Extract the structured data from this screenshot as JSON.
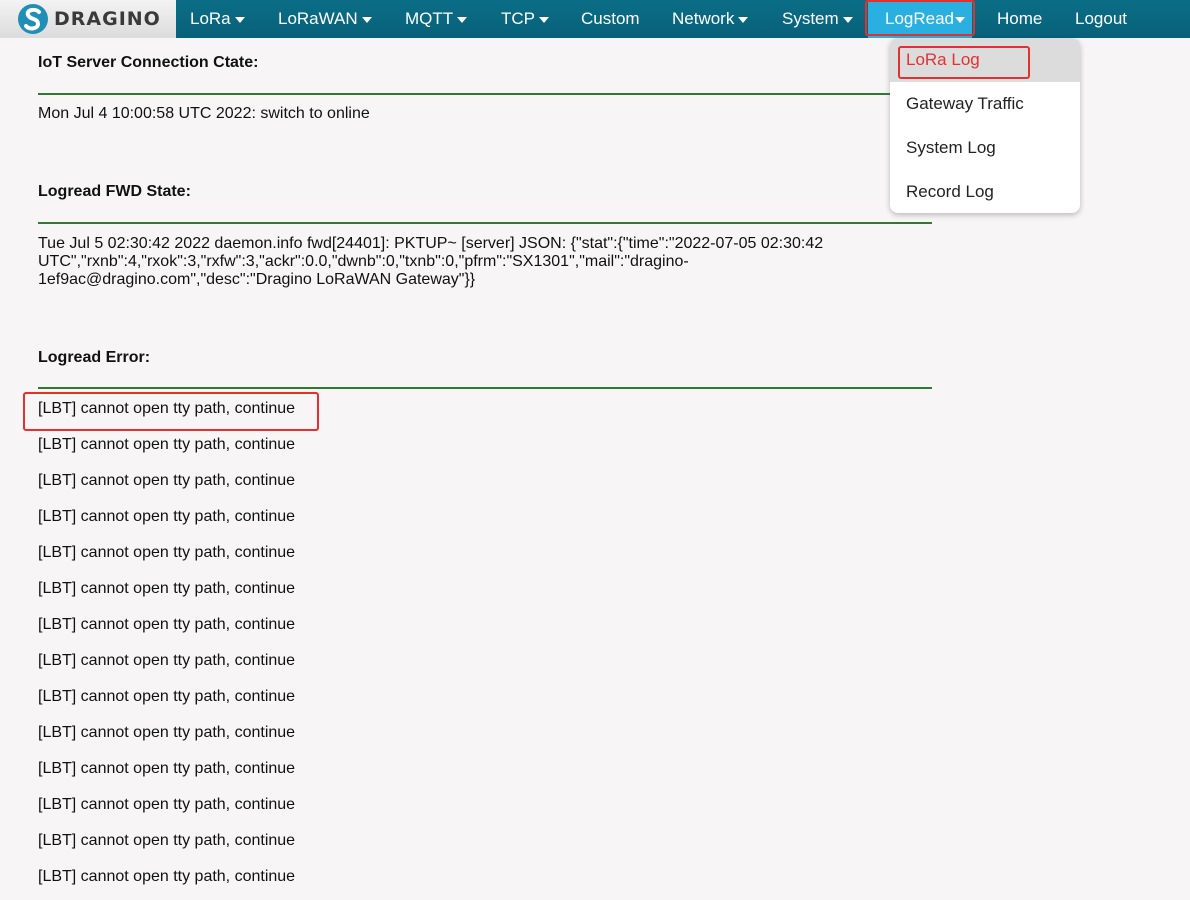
{
  "brand": {
    "name": "DRAGINO",
    "logo_icon": "dragino-s-logo"
  },
  "nav": {
    "lora": "LoRa",
    "lorawan": "LoRaWAN",
    "mqtt": "MQTT",
    "tcp": "TCP",
    "custom": "Custom",
    "network": "Network",
    "system": "System",
    "logread": "LogRead",
    "home": "Home",
    "logout": "Logout"
  },
  "colors": {
    "navbar": "#08607a",
    "active_tab": "#2ab0e0",
    "highlight_box": "#e53030",
    "rule": "#2e7a2e"
  },
  "dropdown": {
    "items": [
      "LoRa Log",
      "Gateway Traffic",
      "System Log",
      "Record Log"
    ]
  },
  "iot_server": {
    "title": "IoT Server Connection Ctate:",
    "text": "Mon Jul 4 10:00:58 UTC 2022: switch to online"
  },
  "fwd_state": {
    "title": "Logread FWD State:",
    "line1": "Tue Jul 5 02:30:42 2022 daemon.info fwd[24401]: PKTUP~ [server] JSON: {\"stat\":{\"time\":\"2022-07-05 02:30:42",
    "line2": "UTC\",\"rxnb\":4,\"rxok\":3,\"rxfw\":3,\"ackr\":0.0,\"dwnb\":0,\"txnb\":0,\"pfrm\":\"SX1301\",\"mail\":\"dragino-",
    "line3": "1ef9ac@dragino.com\",\"desc\":\"Dragino LoRaWAN Gateway\"}}"
  },
  "error": {
    "title": "Logread Error:",
    "lines": [
      "[LBT] cannot open tty path, continue",
      "[LBT] cannot open tty path, continue",
      "[LBT] cannot open tty path, continue",
      "[LBT] cannot open tty path, continue",
      "[LBT] cannot open tty path, continue",
      "[LBT] cannot open tty path, continue",
      "[LBT] cannot open tty path, continue",
      "[LBT] cannot open tty path, continue",
      "[LBT] cannot open tty path, continue",
      "[LBT] cannot open tty path, continue",
      "[LBT] cannot open tty path, continue",
      "[LBT] cannot open tty path, continue",
      "[LBT] cannot open tty path, continue",
      "[LBT] cannot open tty path, continue"
    ]
  }
}
